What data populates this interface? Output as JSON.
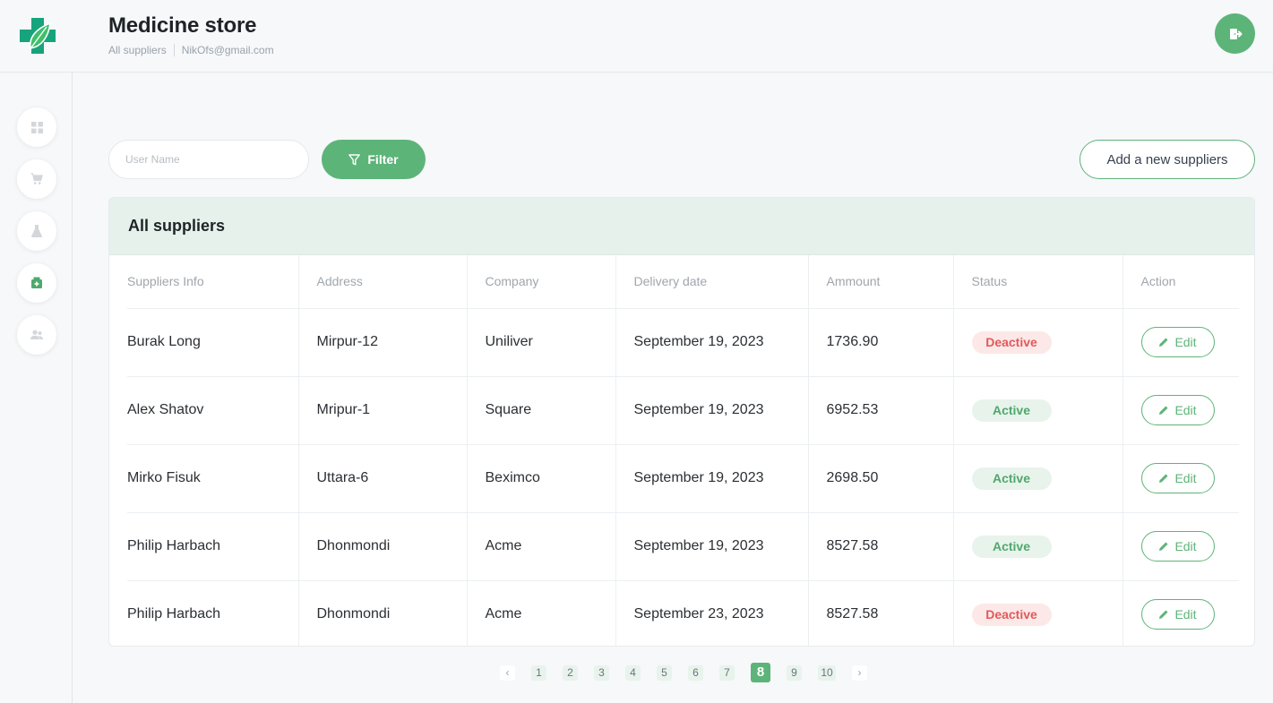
{
  "header": {
    "title": "Medicine store",
    "breadcrumb": "All suppliers",
    "email": "NikOfs@gmail.com"
  },
  "sidebar": {
    "items": [
      {
        "icon": "dashboard-icon"
      },
      {
        "icon": "cart-icon"
      },
      {
        "icon": "flask-icon"
      },
      {
        "icon": "medicine-icon",
        "active": true
      },
      {
        "icon": "users-icon"
      }
    ]
  },
  "toolbar": {
    "search_placeholder": "User Name",
    "filter_label": "Filter",
    "add_label": "Add a new suppliers"
  },
  "table": {
    "title": "All suppliers",
    "columns": [
      "Suppliers Info",
      "Address",
      "Company",
      "Delivery date",
      "Ammount",
      "Status",
      "Action"
    ],
    "edit_label": "Edit",
    "rows": [
      {
        "name": "Burak Long",
        "address": "Mirpur-12",
        "company": "Uniliver",
        "date": "September 19, 2023",
        "amount": "1736.90",
        "status": "Deactive"
      },
      {
        "name": "Alex Shatov",
        "address": "Mripur-1",
        "company": "Square",
        "date": "September 19, 2023",
        "amount": "6952.53",
        "status": "Active"
      },
      {
        "name": "Mirko Fisuk",
        "address": "Uttara-6",
        "company": "Beximco",
        "date": "September 19, 2023",
        "amount": "2698.50",
        "status": "Active"
      },
      {
        "name": "Philip Harbach",
        "address": "Dhonmondi",
        "company": "Acme",
        "date": "September 19, 2023",
        "amount": "8527.58",
        "status": "Active"
      },
      {
        "name": "Philip Harbach",
        "address": "Dhonmondi",
        "company": "Acme",
        "date": "September 23, 2023",
        "amount": "8527.58",
        "status": "Deactive"
      }
    ]
  },
  "pagination": {
    "pages": [
      "1",
      "2",
      "3",
      "4",
      "5",
      "6",
      "7",
      "8",
      "9",
      "10"
    ],
    "current": "8"
  },
  "colors": {
    "accent": "#5db478",
    "header_bg": "#e5f1ea",
    "deactive": "#e05a5a",
    "active": "#4fa86c"
  }
}
